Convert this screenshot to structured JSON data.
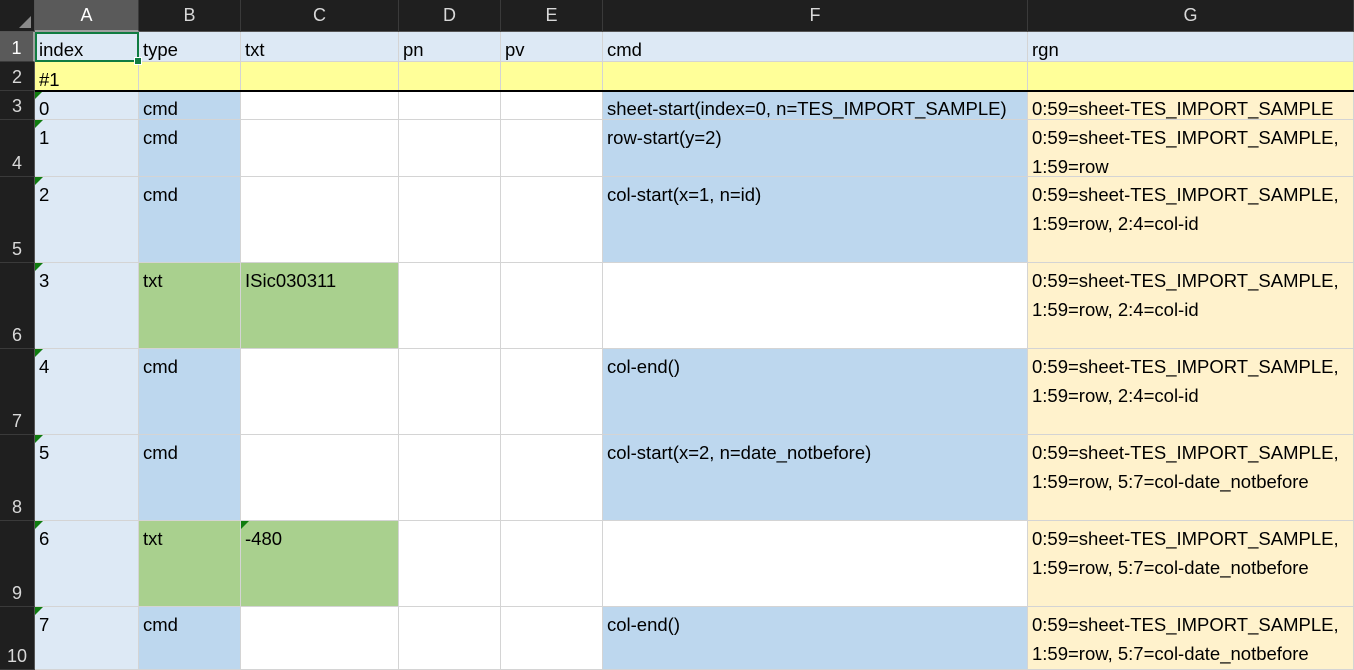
{
  "column_headers": [
    "A",
    "B",
    "C",
    "D",
    "E",
    "F",
    "G"
  ],
  "row_headers": [
    "1",
    "2",
    "3",
    "4",
    "5",
    "6",
    "7",
    "8",
    "9",
    "10"
  ],
  "header_row": {
    "index": "index",
    "type": "type",
    "txt": "txt",
    "pn": "pn",
    "pv": "pv",
    "cmd": "cmd",
    "rgn": "rgn"
  },
  "block_row": {
    "index": "#1"
  },
  "rows": [
    {
      "index": "0",
      "type": "cmd",
      "txt": "",
      "cmd": "sheet-start(index=0, n=TES_IMPORT_SAMPLE)",
      "rgn": "0:59=sheet-TES_IMPORT_SAMPLE"
    },
    {
      "index": "1",
      "type": "cmd",
      "txt": "",
      "cmd": "row-start(y=2)",
      "rgn": "0:59=sheet-TES_IMPORT_SAMPLE, 1:59=row"
    },
    {
      "index": "2",
      "type": "cmd",
      "txt": "",
      "cmd": "col-start(x=1, n=id)",
      "rgn": "0:59=sheet-TES_IMPORT_SAMPLE, 1:59=row, 2:4=col-id"
    },
    {
      "index": "3",
      "type": "txt",
      "txt": "ISic030311",
      "cmd": "",
      "rgn": "0:59=sheet-TES_IMPORT_SAMPLE, 1:59=row, 2:4=col-id"
    },
    {
      "index": "4",
      "type": "cmd",
      "txt": "",
      "cmd": "col-end()",
      "rgn": "0:59=sheet-TES_IMPORT_SAMPLE, 1:59=row, 2:4=col-id"
    },
    {
      "index": "5",
      "type": "cmd",
      "txt": "",
      "cmd": "col-start(x=2, n=date_notbefore)",
      "rgn": "0:59=sheet-TES_IMPORT_SAMPLE, 1:59=row, 5:7=col-date_notbefore"
    },
    {
      "index": "6",
      "type": "txt",
      "txt": "-480",
      "cmd": "",
      "rgn": "0:59=sheet-TES_IMPORT_SAMPLE, 1:59=row, 5:7=col-date_notbefore"
    },
    {
      "index": "7",
      "type": "cmd",
      "txt": "",
      "cmd": "col-end()",
      "rgn": "0:59=sheet-TES_IMPORT_SAMPLE, 1:59=row, 5:7=col-date_notbefore"
    }
  ],
  "colors": {
    "header_fill": "#dde9f5",
    "block_fill": "#ffff99",
    "cmd_fill": "#bdd7ee",
    "txt_fill": "#a9d08e",
    "rgn_fill": "#fff2cc"
  }
}
